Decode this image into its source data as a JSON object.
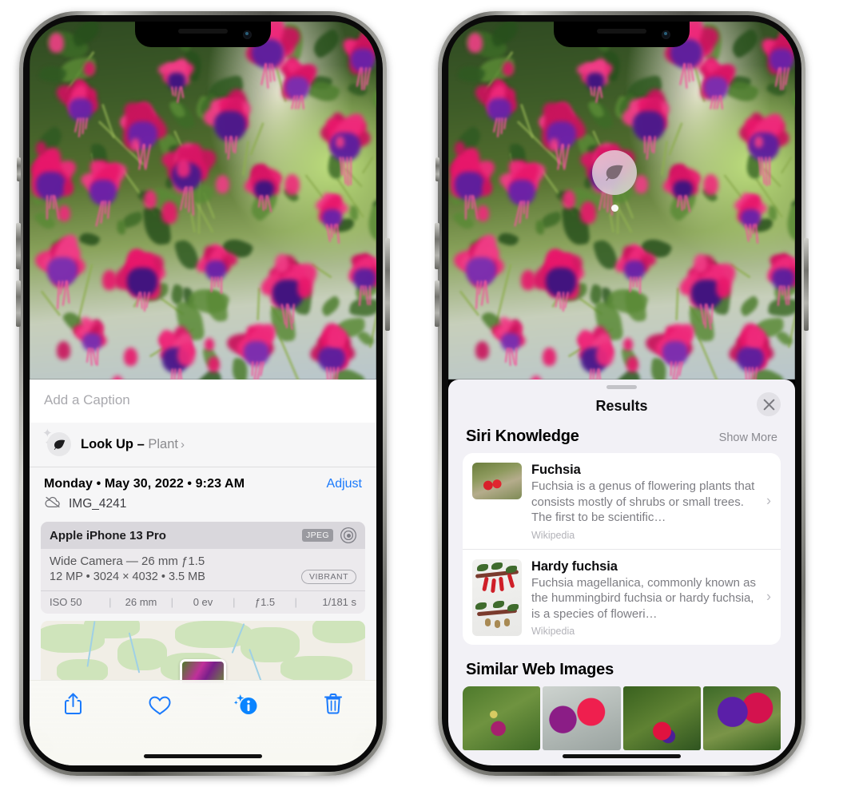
{
  "left_phone": {
    "name": "photos-detail-screen",
    "caption_placeholder": "Add a Caption",
    "lookup": {
      "icon": "leaf-icon",
      "sparkle": "sparkles-icon",
      "label": "Look Up – ",
      "subject": "Plant",
      "chevron": "›"
    },
    "meta": {
      "date": "Monday • May 30, 2022 • 9:23 AM",
      "adjust_label": "Adjust",
      "cloud_icon": "cloud-slash-icon",
      "filename": "IMG_4241"
    },
    "camera_card": {
      "device": "Apple iPhone 13 Pro",
      "format_badge": "JPEG",
      "raw_icon": "raw-target-icon",
      "lens": "Wide Camera — 26 mm ƒ1.5",
      "specs": "12 MP • 3024 × 4032 • 3.5 MB",
      "style_badge": "VIBRANT",
      "exif": [
        "ISO 50",
        "26 mm",
        "0 ev",
        "ƒ1.5",
        "1/181 s"
      ],
      "exif_divider": "|"
    },
    "toolbar": [
      {
        "name": "share-button",
        "icon": "share-icon"
      },
      {
        "name": "favorite-button",
        "icon": "heart-icon"
      },
      {
        "name": "info-button",
        "icon": "info-sparkle-icon"
      },
      {
        "name": "delete-button",
        "icon": "trash-icon"
      }
    ]
  },
  "right_phone": {
    "name": "visual-lookup-results-screen",
    "photo_badge": {
      "icon": "leaf-icon"
    },
    "sheet": {
      "title": "Results",
      "close_icon": "close-icon",
      "grabber": "drag-handle"
    },
    "siri_knowledge": {
      "title": "Siri Knowledge",
      "show_more": "Show More",
      "cards": [
        {
          "title": "Fuchsia",
          "description": "Fuchsia is a genus of flowering plants that consists mostly of shrubs or small trees. The first to be scientific…",
          "source": "Wikipedia",
          "chevron": "›"
        },
        {
          "title": "Hardy fuchsia",
          "description": "Fuchsia magellanica, commonly known as the hummingbird fuchsia or hardy fuchsia, is a species of floweri…",
          "source": "Wikipedia",
          "chevron": "›"
        }
      ]
    },
    "similar_web_images": {
      "title": "Similar Web Images",
      "count": 4
    }
  },
  "colors": {
    "accent_blue": "#1a7afc",
    "sheet_bg": "#f2f1f6",
    "card_white": "#ffffff",
    "secondary_text": "#8a8a90",
    "badge_grey": "#9a9aa0"
  }
}
